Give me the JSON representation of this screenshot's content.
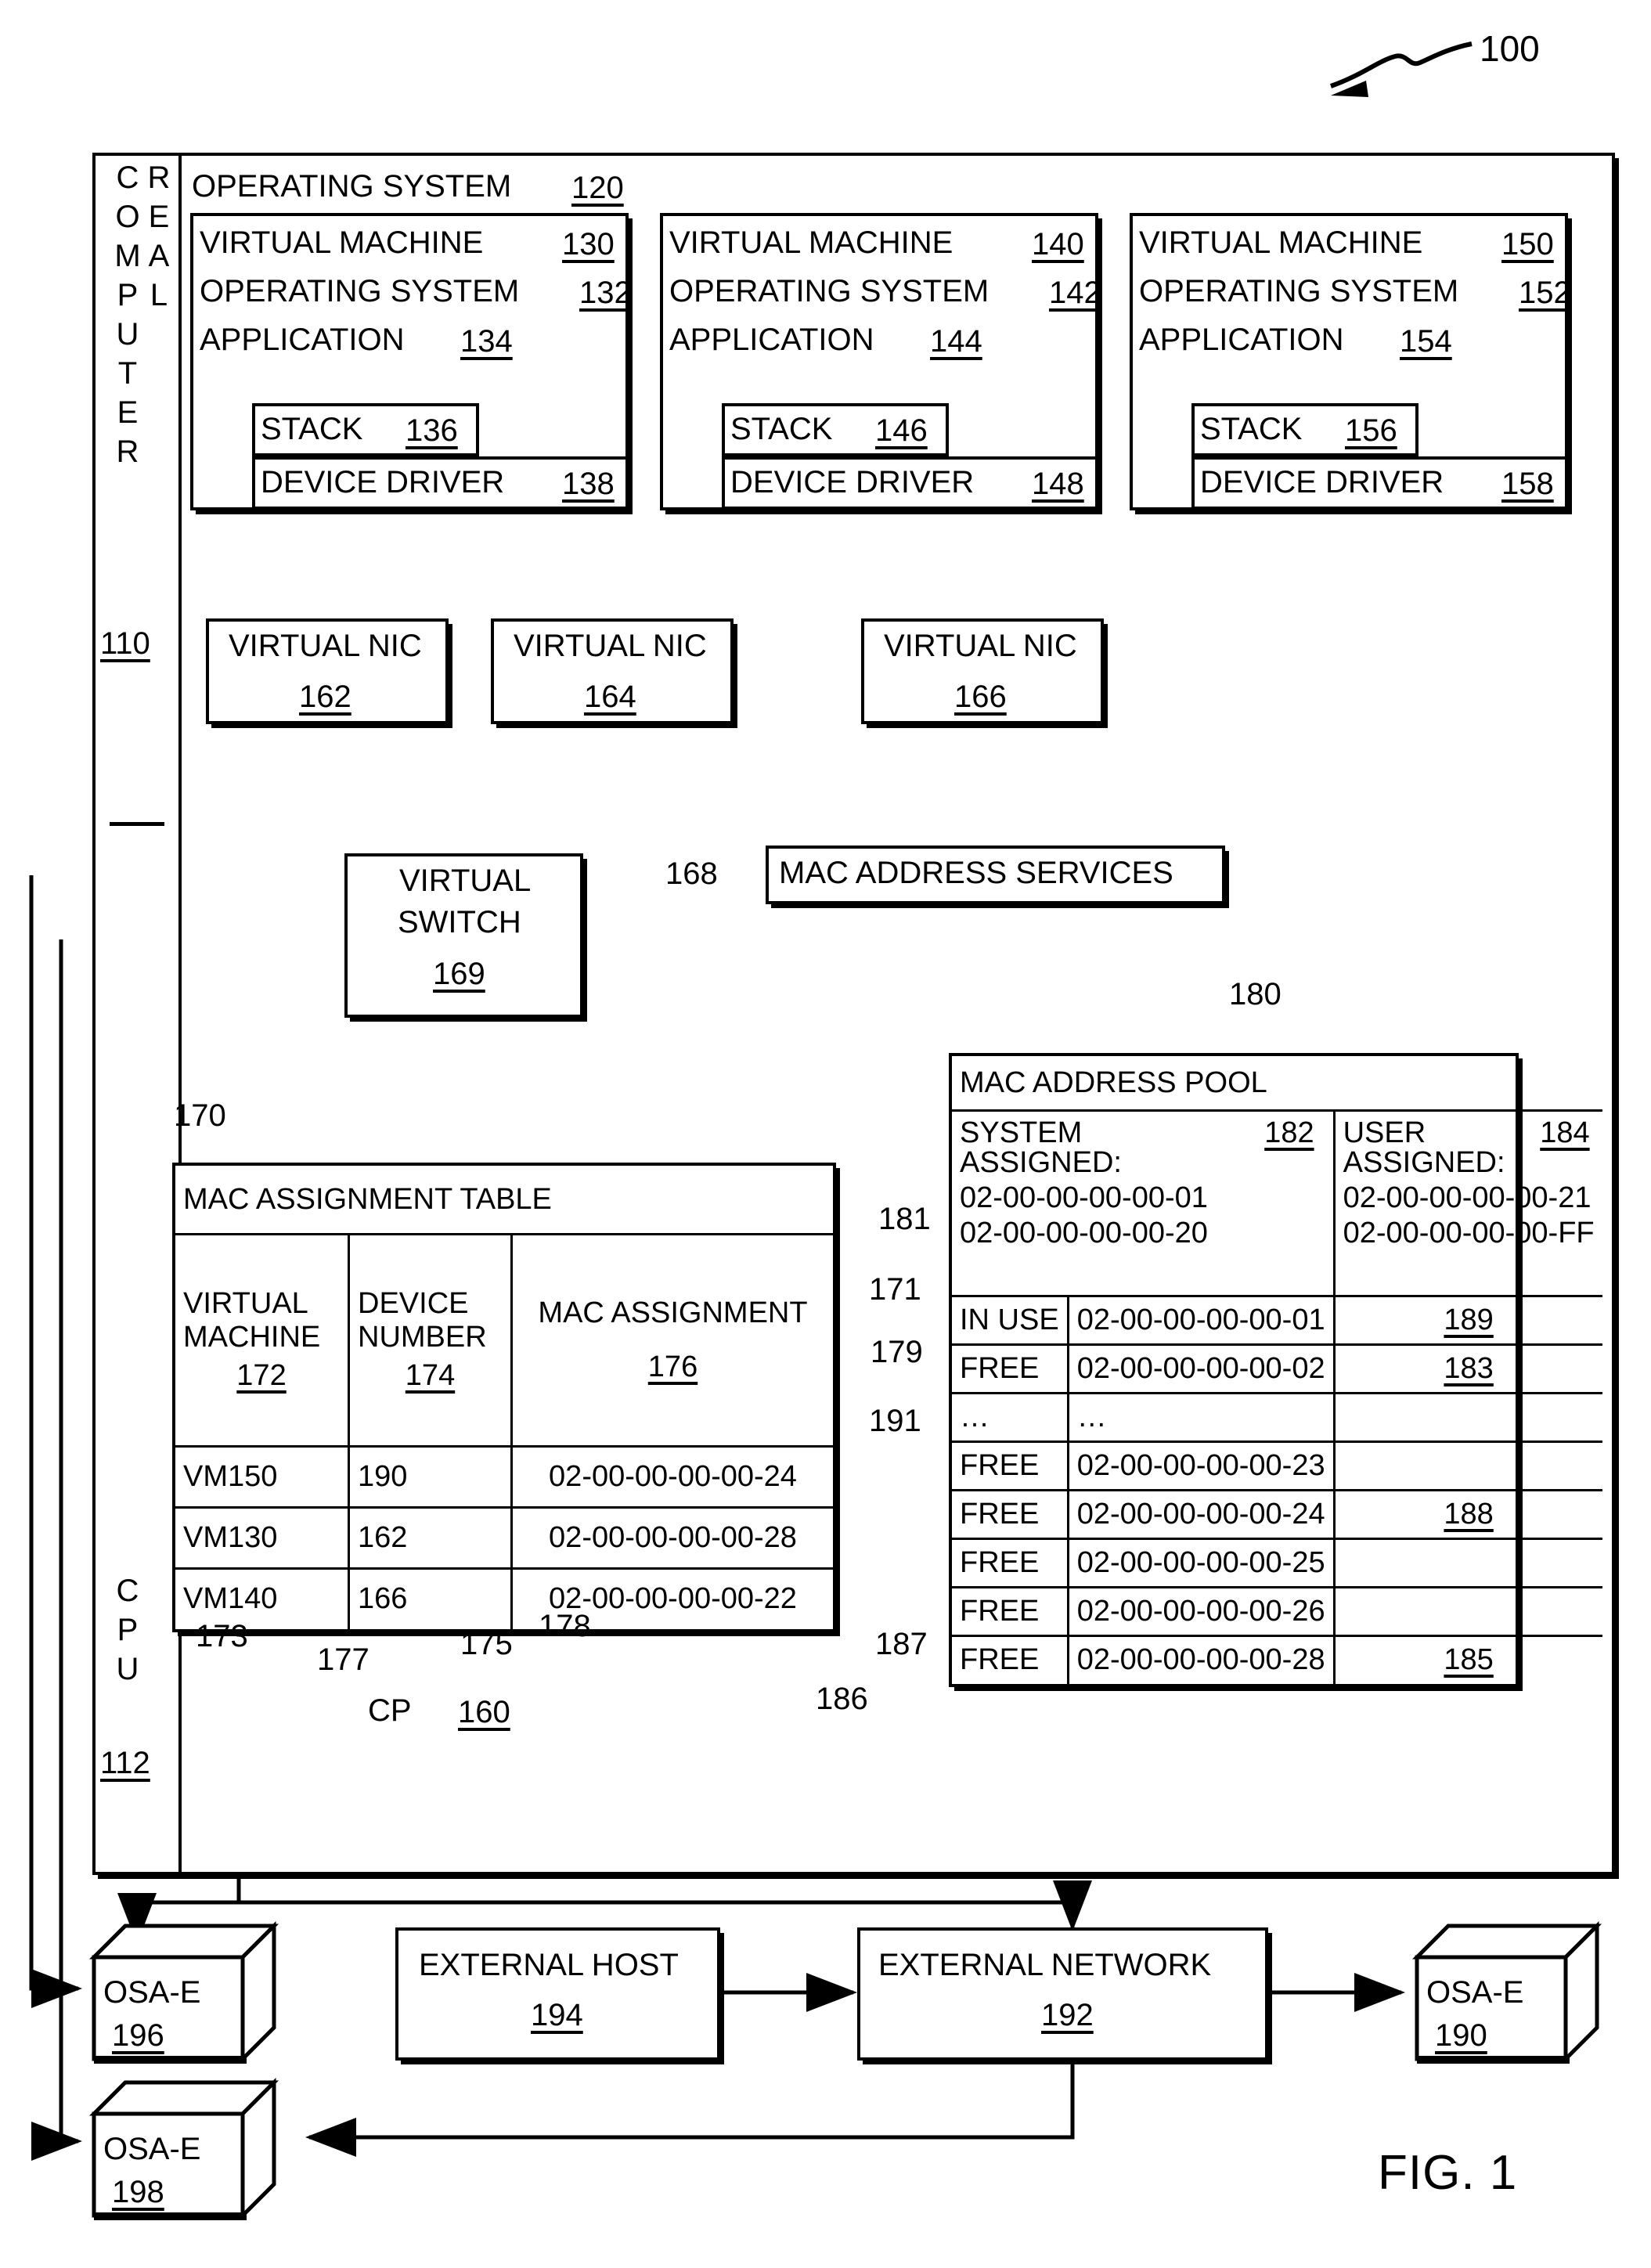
{
  "figure": {
    "label": "FIG. 1",
    "system_ref": "100"
  },
  "real_computer": {
    "label": "REAL COMPUTER",
    "ref": "110"
  },
  "cpu": {
    "label": "CPU",
    "ref": "112"
  },
  "host_os": {
    "label": "OPERATING SYSTEM",
    "ref": "120"
  },
  "vms": [
    {
      "title": "VIRTUAL MACHINE",
      "ref": "130",
      "os_label": "OPERATING SYSTEM",
      "os_ref": "132",
      "app_label": "APPLICATION",
      "app_ref": "134",
      "stack_label": "STACK",
      "stack_ref": "136",
      "driver_label": "DEVICE DRIVER",
      "driver_ref": "138"
    },
    {
      "title": "VIRTUAL MACHINE",
      "ref": "140",
      "os_label": "OPERATING SYSTEM",
      "os_ref": "142",
      "app_label": "APPLICATION",
      "app_ref": "144",
      "stack_label": "STACK",
      "stack_ref": "146",
      "driver_label": "DEVICE DRIVER",
      "driver_ref": "148"
    },
    {
      "title": "VIRTUAL MACHINE",
      "ref": "150",
      "os_label": "OPERATING SYSTEM",
      "os_ref": "152",
      "app_label": "APPLICATION",
      "app_ref": "154",
      "stack_label": "STACK",
      "stack_ref": "156",
      "driver_label": "DEVICE DRIVER",
      "driver_ref": "158"
    }
  ],
  "nics": [
    {
      "label": "VIRTUAL NIC",
      "ref": "162"
    },
    {
      "label": "VIRTUAL NIC",
      "ref": "164"
    },
    {
      "label": "VIRTUAL NIC",
      "ref": "166"
    }
  ],
  "mac_services": {
    "label": "MAC ADDRESS SERVICES",
    "ref": "168"
  },
  "virtual_switch": {
    "line1": "VIRTUAL",
    "line2": "SWITCH",
    "ref": "169"
  },
  "cp": {
    "label": "CP",
    "ref": "160"
  },
  "mac_assignment_table": {
    "ref": "170",
    "title": "MAC ASSIGNMENT TABLE",
    "columns": [
      {
        "line1": "VIRTUAL",
        "line2": "MACHINE",
        "ref": "172"
      },
      {
        "line1": "DEVICE",
        "line2": "NUMBER",
        "ref": "174"
      },
      {
        "line1": "MAC ASSIGNMENT",
        "line2": "",
        "ref": "176"
      }
    ],
    "rows": [
      {
        "vm": "VM150",
        "device": "190",
        "mac": "02-00-00-00-00-24"
      },
      {
        "vm": "VM130",
        "device": "162",
        "mac": "02-00-00-00-00-28"
      },
      {
        "vm": "VM140",
        "device": "166",
        "mac": "02-00-00-00-00-22"
      }
    ],
    "callouts": [
      "173",
      "177",
      "175",
      "178"
    ]
  },
  "mac_address_pool": {
    "ref": "180",
    "title": "MAC ADDRESS POOL",
    "system_assigned": {
      "label_line1": "SYSTEM",
      "label_line2": "ASSIGNED:",
      "ref": "182",
      "range_start": "02-00-00-00-00-01",
      "range_end": "02-00-00-00-00-20"
    },
    "user_assigned": {
      "label_line1": "USER",
      "label_line2": "ASSIGNED:",
      "ref": "184",
      "range_start": "02-00-00-00-00-21",
      "range_end": "02-00-00-00-00-FF"
    },
    "rows": [
      {
        "status": "IN USE",
        "mac": "02-00-00-00-00-01",
        "ref": "189"
      },
      {
        "status": "FREE",
        "mac": "02-00-00-00-00-02",
        "ref": "183"
      },
      {
        "status": "…",
        "mac": "…",
        "ref": ""
      },
      {
        "status": "FREE",
        "mac": "02-00-00-00-00-23",
        "ref": ""
      },
      {
        "status": "FREE",
        "mac": "02-00-00-00-00-24",
        "ref": "188"
      },
      {
        "status": "FREE",
        "mac": "02-00-00-00-00-25",
        "ref": ""
      },
      {
        "status": "FREE",
        "mac": "02-00-00-00-00-26",
        "ref": ""
      },
      {
        "status": "FREE",
        "mac": "02-00-00-00-00-28",
        "ref": "185"
      }
    ],
    "callouts": [
      "181",
      "171",
      "179",
      "191",
      "187",
      "186"
    ]
  },
  "external": {
    "osa_left_top": {
      "label": "OSA-E",
      "ref": "196"
    },
    "osa_left_bottom": {
      "label": "OSA-E",
      "ref": "198"
    },
    "osa_right": {
      "label": "OSA-E",
      "ref": "190"
    },
    "host": {
      "label": "EXTERNAL HOST",
      "ref": "194"
    },
    "network": {
      "label": "EXTERNAL NETWORK",
      "ref": "192"
    }
  }
}
